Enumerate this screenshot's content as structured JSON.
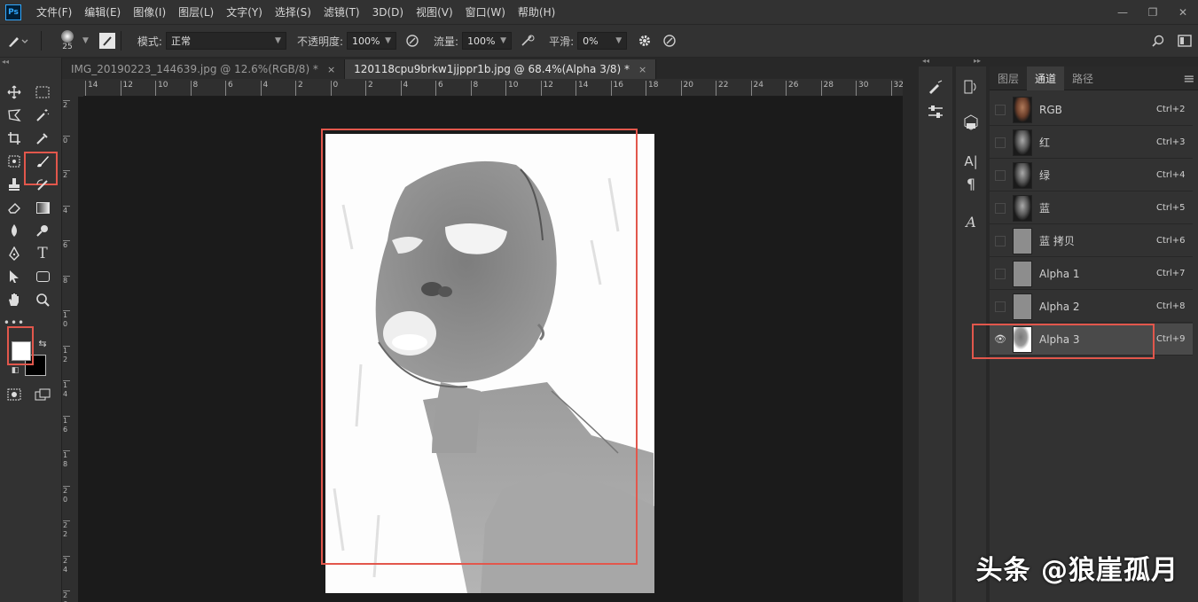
{
  "app": {
    "logo": "Ps"
  },
  "menu": [
    "文件(F)",
    "编辑(E)",
    "图像(I)",
    "图层(L)",
    "文字(Y)",
    "选择(S)",
    "滤镜(T)",
    "3D(D)",
    "视图(V)",
    "窗口(W)",
    "帮助(H)"
  ],
  "window_controls": {
    "minimize": "—",
    "restore": "❐",
    "close": "✕"
  },
  "options": {
    "brush_size": "25",
    "mode_label": "模式:",
    "mode_value": "正常",
    "opacity_label": "不透明度:",
    "opacity_value": "100%",
    "flow_label": "流量:",
    "flow_value": "100%",
    "smooth_label": "平滑:",
    "smooth_value": "0%"
  },
  "tabs": [
    {
      "label": "IMG_20190223_144639.jpg @ 12.6%(RGB/8) *",
      "close": "×",
      "active": false
    },
    {
      "label": "120118cpu9brkw1jjppr1b.jpg @ 68.4%(Alpha 3/8) *",
      "close": "×",
      "active": true
    }
  ],
  "ruler_h": [
    "14",
    "12",
    "10",
    "8",
    "6",
    "4",
    "2",
    "0",
    "2",
    "4",
    "6",
    "8",
    "10",
    "12",
    "14",
    "16",
    "18",
    "20",
    "22",
    "24",
    "26",
    "28",
    "30",
    "32"
  ],
  "ruler_v": [
    "2",
    "0",
    "2",
    "4",
    "6",
    "8",
    "1 0",
    "1 2",
    "1 4",
    "1 6",
    "1 8",
    "2 0",
    "2 2",
    "2 4",
    "2 6"
  ],
  "panel": {
    "tabs": [
      "图层",
      "通道",
      "路径"
    ],
    "active_tab": "通道",
    "menu_icon": "≡",
    "channels": [
      {
        "name": "RGB",
        "shortcut": "Ctrl+2",
        "visible": false
      },
      {
        "name": "红",
        "shortcut": "Ctrl+3",
        "visible": false
      },
      {
        "name": "绿",
        "shortcut": "Ctrl+4",
        "visible": false
      },
      {
        "name": "蓝",
        "shortcut": "Ctrl+5",
        "visible": false
      },
      {
        "name": "蓝 拷贝",
        "shortcut": "Ctrl+6",
        "visible": false
      },
      {
        "name": "Alpha 1",
        "shortcut": "Ctrl+7",
        "visible": false
      },
      {
        "name": "Alpha 2",
        "shortcut": "Ctrl+8",
        "visible": false
      },
      {
        "name": "Alpha 3",
        "shortcut": "Ctrl+9",
        "visible": true
      }
    ]
  },
  "side_icons": {
    "a_label": "A|",
    "para": "¶",
    "a2": "A"
  },
  "watermark": "头条 @狼崖孤月",
  "colors": {
    "highlight": "#e2574c",
    "accent": "#31a8ff",
    "foreground": "#ffffff",
    "background": "#000000"
  }
}
